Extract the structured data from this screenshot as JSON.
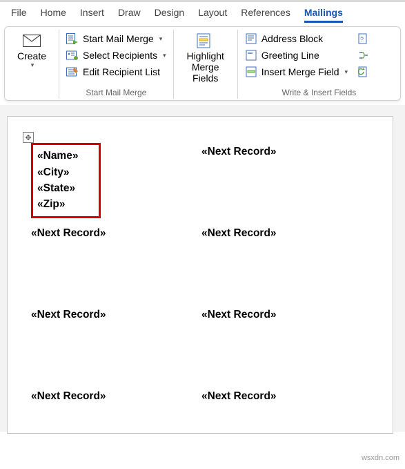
{
  "tabs": {
    "file": "File",
    "home": "Home",
    "insert": "Insert",
    "draw": "Draw",
    "design": "Design",
    "layout": "Layout",
    "references": "References",
    "mailings": "Mailings"
  },
  "ribbon": {
    "create": {
      "label": "Create"
    },
    "startMerge": {
      "startMailMerge": "Start Mail Merge",
      "selectRecipients": "Select Recipients",
      "editRecipientList": "Edit Recipient List",
      "groupLabel": "Start Mail Merge"
    },
    "highlight": {
      "line1": "Highlight",
      "line2": "Merge Fields"
    },
    "writeInsert": {
      "addressBlock": "Address Block",
      "greetingLine": "Greeting Line",
      "insertMergeField": "Insert Merge Field",
      "groupLabel": "Write & Insert Fields"
    }
  },
  "document": {
    "fields": {
      "name": "«Name»",
      "city": "«City»",
      "state": "«State»",
      "zip": "«Zip»"
    },
    "nextRecord": "«Next Record»"
  },
  "watermark": "wsxdn.com"
}
